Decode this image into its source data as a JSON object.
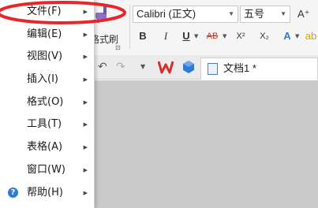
{
  "menu": {
    "items": [
      {
        "label": "文件(F)"
      },
      {
        "label": "编辑(E)"
      },
      {
        "label": "视图(V)"
      },
      {
        "label": "插入(I)"
      },
      {
        "label": "格式(O)"
      },
      {
        "label": "工具(T)"
      },
      {
        "label": "表格(A)"
      },
      {
        "label": "窗口(W)"
      },
      {
        "label": "帮助(H)"
      }
    ],
    "arrow_glyph": "▶"
  },
  "toolbar": {
    "font_name": "Calibri (正文)",
    "font_size": "五号",
    "format_painter_label": "格式刷",
    "bold": "B",
    "italic": "I",
    "underline": "U",
    "strike": "AB",
    "superscript": "X²",
    "subscript": "X₂",
    "grow_font": "A⁺"
  },
  "tabs": {
    "document_tab": "文档1 *"
  },
  "annotation_color": "#e8262a",
  "accent_wps": "#d62c2c",
  "accent_blue": "#2f7ad6"
}
